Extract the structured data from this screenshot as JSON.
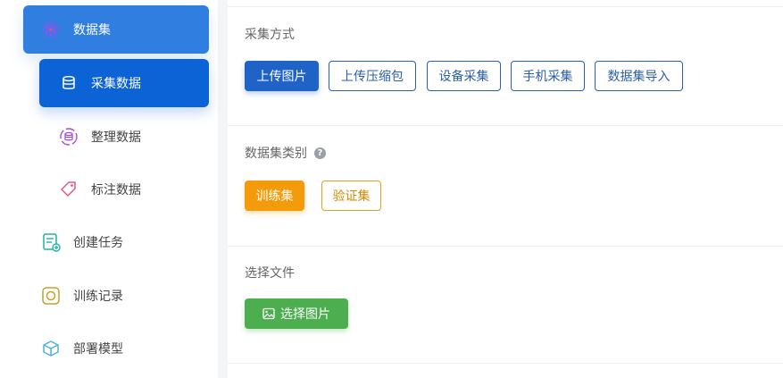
{
  "sidebar": {
    "items": [
      {
        "label": "数据集",
        "icon": "atom-icon"
      },
      {
        "label": "采集数据",
        "icon": "database-icon"
      },
      {
        "label": "整理数据",
        "icon": "database-sync-icon"
      },
      {
        "label": "标注数据",
        "icon": "tag-icon"
      },
      {
        "label": "创建任务",
        "icon": "task-add-icon"
      },
      {
        "label": "训练记录",
        "icon": "train-record-icon"
      },
      {
        "label": "部署模型",
        "icon": "cube-icon"
      }
    ]
  },
  "main": {
    "collect_method": {
      "title": "采集方式",
      "buttons": [
        "上传图片",
        "上传压缩包",
        "设备采集",
        "手机采集",
        "数据集导入"
      ]
    },
    "dataset_type": {
      "title": "数据集类别",
      "help": "?",
      "buttons": [
        "训练集",
        "验证集"
      ]
    },
    "select_file": {
      "title": "选择文件",
      "button": "选择图片",
      "button_icon": "image-icon"
    }
  },
  "colors": {
    "active_blue": "#0b63d6",
    "dataset_blue": "#2f7ee0",
    "primary_blue": "#1f63c6",
    "orange": "#f49b0b",
    "green": "#4cae4f"
  }
}
